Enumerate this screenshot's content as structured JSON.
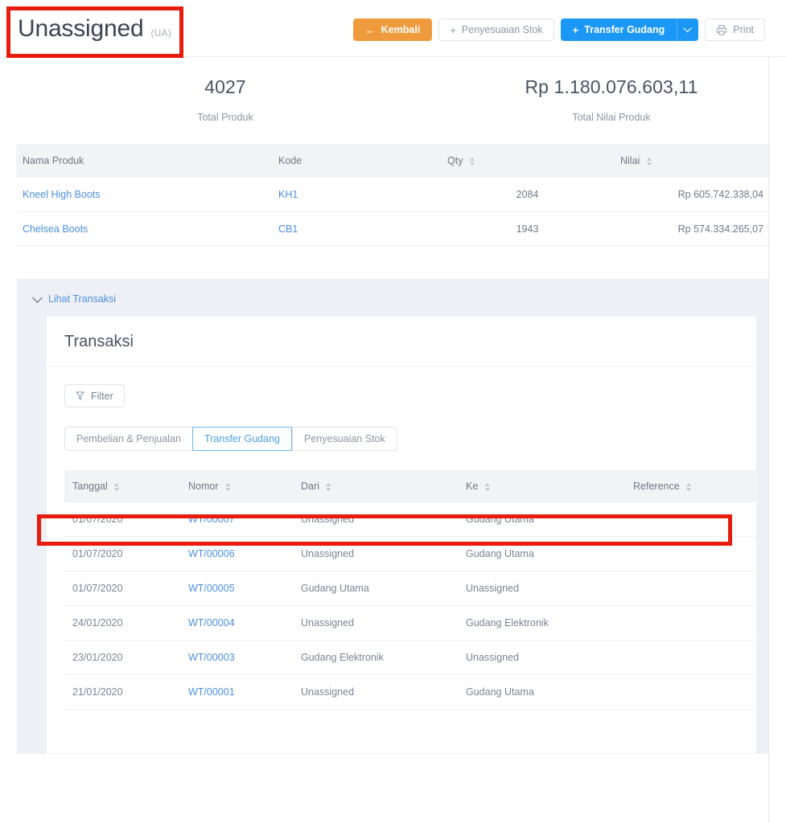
{
  "header": {
    "title": "Unassigned",
    "code": "(UA)",
    "buttons": {
      "back": {
        "label": "Kembali",
        "icon": "arrow-left-icon",
        "color": "#ef9b3d"
      },
      "stock_adjustment": {
        "label": "Penyesuaian Stok",
        "icon": "plus-icon"
      },
      "warehouse_transfer": {
        "label": "Transfer Gudang",
        "icon": "plus-icon",
        "color": "#1b97f5"
      },
      "warehouse_transfer_caret": {
        "icon": "chevron-down-icon"
      },
      "print": {
        "label": "Print",
        "icon": "printer-icon"
      }
    }
  },
  "stats": [
    {
      "value": "4027",
      "label": "Total Produk"
    },
    {
      "value": "Rp 1.180.076.603,11",
      "label": "Total Nilai Produk"
    }
  ],
  "product_table": {
    "columns": [
      {
        "label": "Nama Produk",
        "sortable": false,
        "align": "left"
      },
      {
        "label": "Kode",
        "sortable": false,
        "align": "left"
      },
      {
        "label": "Qty",
        "sortable": true,
        "align": "center"
      },
      {
        "label": "Nilai",
        "sortable": true,
        "align": "right"
      }
    ],
    "rows": [
      {
        "nama_produk": "Kneel High Boots",
        "kode": "KH1",
        "qty": "2084",
        "nilai": "Rp 605.742.338,04"
      },
      {
        "nama_produk": "Chelsea Boots",
        "kode": "CB1",
        "qty": "1943",
        "nilai": "Rp 574.334.265,07"
      }
    ]
  },
  "transactions_panel": {
    "toggle_label": "Lihat Transaksi",
    "card_title": "Transaksi",
    "filter_label": "Filter",
    "filter_icon": "funnel-icon",
    "tabs": [
      {
        "label": "Pembelian & Penjualan",
        "active": false
      },
      {
        "label": "Transfer Gudang",
        "active": true
      },
      {
        "label": "Penyesuaian Stok",
        "active": false
      }
    ],
    "table": {
      "columns": [
        {
          "label": "Tanggal",
          "sortable": true
        },
        {
          "label": "Nomor",
          "sortable": true
        },
        {
          "label": "Dari",
          "sortable": true
        },
        {
          "label": "Ke",
          "sortable": true
        },
        {
          "label": "Reference",
          "sortable": true
        }
      ],
      "rows": [
        {
          "tanggal": "01/07/2020",
          "nomor": "WT/00007",
          "dari": "Unassigned",
          "ke": "Gudang Utama",
          "reference": ""
        },
        {
          "tanggal": "01/07/2020",
          "nomor": "WT/00006",
          "dari": "Unassigned",
          "ke": "Gudang Utama",
          "reference": ""
        },
        {
          "tanggal": "01/07/2020",
          "nomor": "WT/00005",
          "dari": "Gudang Utama",
          "ke": "Unassigned",
          "reference": ""
        },
        {
          "tanggal": "24/01/2020",
          "nomor": "WT/00004",
          "dari": "Unassigned",
          "ke": "Gudang Elektronik",
          "reference": ""
        },
        {
          "tanggal": "23/01/2020",
          "nomor": "WT/00003",
          "dari": "Gudang Elektronik",
          "ke": "Unassigned",
          "reference": ""
        },
        {
          "tanggal": "21/01/2020",
          "nomor": "WT/00001",
          "dari": "Unassigned",
          "ke": "Gudang Utama",
          "reference": ""
        }
      ]
    }
  },
  "annotations": {
    "color": "#e81c0d",
    "boxes": [
      {
        "name": "title-highlight"
      },
      {
        "name": "first-transaction-row-highlight"
      }
    ]
  }
}
